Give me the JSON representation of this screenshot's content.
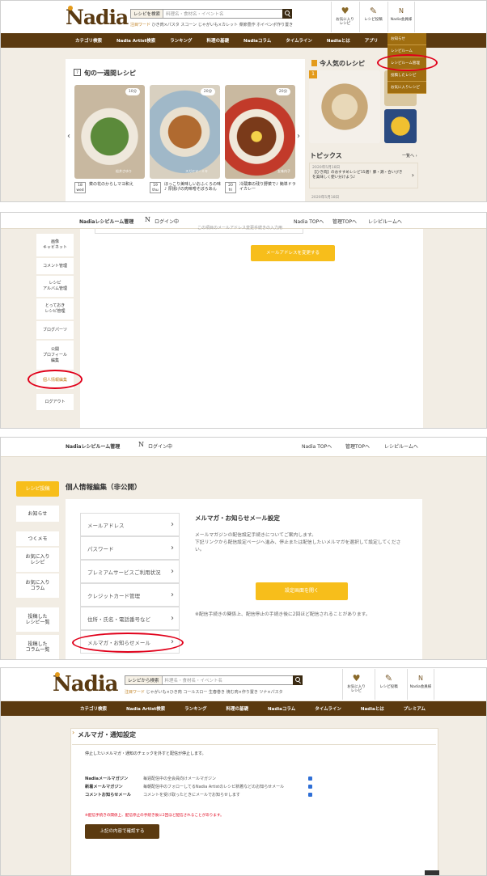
{
  "brand": {
    "name": "Nadia"
  },
  "header": {
    "search_select": "レシピを検索",
    "search_select2": "レシピから検索",
    "search_placeholder": "料理名・食材名・イベント名",
    "keywords1": [
      "注目ワード",
      "ひき肉×パスタ",
      "スコーン",
      "じゃがいも×カレット",
      "菜節豊作",
      "ホイペンポ作り置き"
    ],
    "keywords4": [
      "注目ワード",
      "じゃがいも×ひき肉",
      "コールスロー",
      "生春巻き",
      "焼む肉×作り置き",
      "ツナ×パスタ"
    ],
    "btn_fav": "お気に入り\nレシピ",
    "btn_post": "レシピ投稿",
    "btn_menu": "Nadia会員様"
  },
  "nav1": [
    "カテゴリ検索",
    "Nadia Artist検索",
    "ランキング",
    "料理の基礎",
    "Nadiaコラム",
    "タイムライン",
    "Nadiaとは",
    "アプリ"
  ],
  "nav4": [
    "カテゴリ検索",
    "Nadia Artist検索",
    "ランキング",
    "料理の基礎",
    "Nadiaコラム",
    "タイムライン",
    "Nadiaとは",
    "プレミアム"
  ],
  "dropdown": [
    "お知らせ",
    "レシピルーム",
    "レシピルーム管理",
    "投稿したレシピ",
    "お気に入りレシピ"
  ],
  "panel1": {
    "weekly_title": "旬の一週間レシピ",
    "popular_title": "今人気のレシピ",
    "topics_title": "トピックス",
    "topics_more": "一覧へ ›",
    "topic1_date": "2020年5月18日",
    "topic1_text": "【ひき肉】のおすすめレシピ15選！豚・鶏・合いびきを美味しく使い分けよう♪",
    "topic2_date": "2020年5月18日",
    "popular_rank": "1",
    "recipes": [
      {
        "date": "18",
        "dow": "wed",
        "badge": "10分",
        "author": "松井さゆり",
        "title": "菜の花のからしマヨ和え"
      },
      {
        "date": "19",
        "dow": "thu",
        "badge": "20分",
        "author": "スガヤマ・ミキ",
        "title": "ほっこり美味しいおふくろの味♪ 厚揚げの肉味噌そぼろあん"
      },
      {
        "date": "20",
        "dow": "fri",
        "badge": "20分",
        "author": "五味内子",
        "title": "冷蔵庫の残り野菜で♪ 簡単ドライカレー"
      }
    ]
  },
  "panel2": {
    "room_title": "Nadiaレシピルーム管理",
    "login": "ログイン中",
    "links": [
      "Nadia TOPへ",
      "管理TOPへ",
      "レシピルームへ"
    ],
    "cut_text": "この項目のメールアドレス変更手続きの入力用",
    "sidebar": [
      "画像\nキャビネット",
      "コメント管理",
      "レシピ\nアルバム管理",
      "とっておき\nレシピ管理",
      "ブログパーツ",
      "公開\nプロフィール\n編集",
      "個人情報編集",
      "ログアウト"
    ],
    "change_email_btn": "メールアドレスを変更する"
  },
  "panel3": {
    "room_title": "Nadiaレシピルーム管理",
    "login": "ログイン中",
    "links": [
      "Nadia TOPへ",
      "管理TOPへ",
      "レシピルームへ"
    ],
    "page_title": "個人情報編集（非公開）",
    "sidebar": [
      "レシピ投稿",
      "お知らせ",
      "つくメモ",
      "お気に入り\nレシピ",
      "お気に入り\nコラム",
      "投稿した\nレシピ一覧",
      "投稿した\nコラム一覧"
    ],
    "menu": [
      "メールアドレス",
      "パスワード",
      "プレミアムサービスご利用状況",
      "クレジットカード管理",
      "住所・氏名・電話番号など",
      "メルマガ・お知らせメール"
    ],
    "section_title": "メルマガ・お知らせメール設定",
    "desc": "メールマガジンの配信設定手続きについてご案内します。\n下記リンクから配信設定ページへ進み、停止または配信したいメルマガを選択して設定してください。",
    "open_btn": "設定画面を開く",
    "note": "※配信手続きの関係上、配信停止の手続き後に2回ほど配信されることがあります。"
  },
  "panel4": {
    "title": "メルマガ・通知設定",
    "intro": "停止したいメルマガ・通知のチェックを外すと配信が停止します。",
    "rows": [
      {
        "label": "Nadiaメールマガジン",
        "desc": "毎週配信中の全会員向けメールマガジン"
      },
      {
        "label": "新着メールマガジン",
        "desc": "毎朝配信中のフォローしてるNadia Artistのレシピ新着などのお知らせメール"
      },
      {
        "label": "コメントお知らせメール",
        "desc": "コメントを受け取ったときにメールでお知らせします"
      }
    ],
    "warning": "※配信手続きの関係上、配信停止の手続き後に2回ほど配信されることがあります。",
    "confirm_btn": "上記の内容で確認する"
  },
  "colors": {
    "brown": "#5b3a10",
    "yellow": "#f7be1b",
    "red": "#e0001a",
    "orange": "#e39a1a"
  }
}
